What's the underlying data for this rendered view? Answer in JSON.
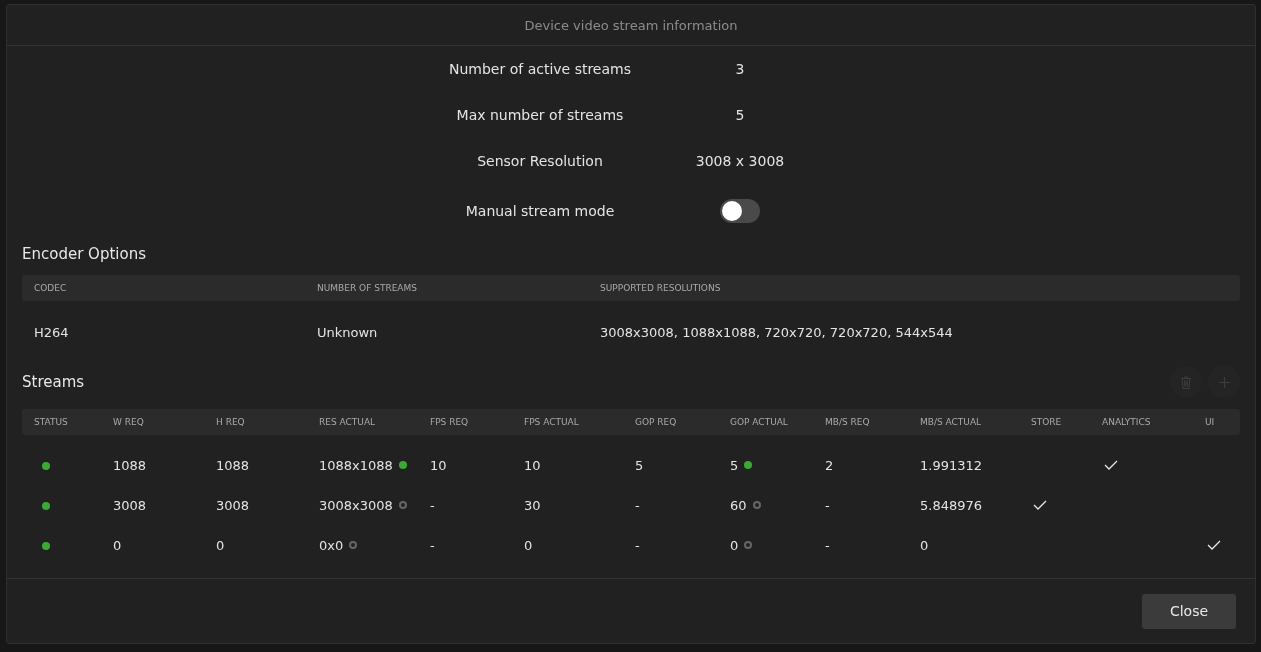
{
  "dialog": {
    "title": "Device video stream information"
  },
  "info": [
    {
      "label": "Number of active streams",
      "value": "3"
    },
    {
      "label": "Max number of streams",
      "value": "5"
    },
    {
      "label": "Sensor Resolution",
      "value": "3008 x 3008"
    }
  ],
  "manual_stream_mode": {
    "label": "Manual stream mode",
    "on": false
  },
  "encoder_options": {
    "title": "Encoder Options",
    "columns": [
      "CODEC",
      "NUMBER OF STREAMS",
      "SUPPORTED RESOLUTIONS"
    ],
    "rows": [
      [
        "H264",
        "Unknown",
        "3008x3008, 1088x1088, 720x720, 720x720, 544x544"
      ]
    ]
  },
  "streams": {
    "title": "Streams",
    "delete_disabled": true,
    "add_disabled": true,
    "columns": [
      "STATUS",
      "W REQ",
      "H REQ",
      "RES ACTUAL",
      "FPS REQ",
      "FPS ACTUAL",
      "GOP REQ",
      "GOP ACTUAL",
      "MB/S REQ",
      "MB/S ACTUAL",
      "STORE",
      "ANALYTICS",
      "UI"
    ],
    "rows": [
      {
        "color": "#3aa935",
        "w_req": "1088",
        "h_req": "1088",
        "res_actual": "1088x1088",
        "res_match": true,
        "fps_req": "10",
        "fps_actual": "10",
        "gop_req": "5",
        "gop_actual": "5",
        "gop_match": true,
        "mbs_req": "2",
        "mbs_actual": "1.991312",
        "store": false,
        "analytics": true,
        "ui": false
      },
      {
        "color": "#3aa935",
        "w_req": "3008",
        "h_req": "3008",
        "res_actual": "3008x3008",
        "res_match": false,
        "fps_req": "-",
        "fps_actual": "30",
        "gop_req": "-",
        "gop_actual": "60",
        "gop_match": false,
        "mbs_req": "-",
        "mbs_actual": "5.848976",
        "store": true,
        "analytics": false,
        "ui": false
      },
      {
        "color": "#3aa935",
        "w_req": "0",
        "h_req": "0",
        "res_actual": "0x0",
        "res_match": false,
        "fps_req": "-",
        "fps_actual": "0",
        "gop_req": "-",
        "gop_actual": "0",
        "gop_match": false,
        "mbs_req": "-",
        "mbs_actual": "0",
        "store": false,
        "analytics": false,
        "ui": true
      }
    ]
  },
  "buttons": [
    {
      "label": "Close"
    }
  ]
}
